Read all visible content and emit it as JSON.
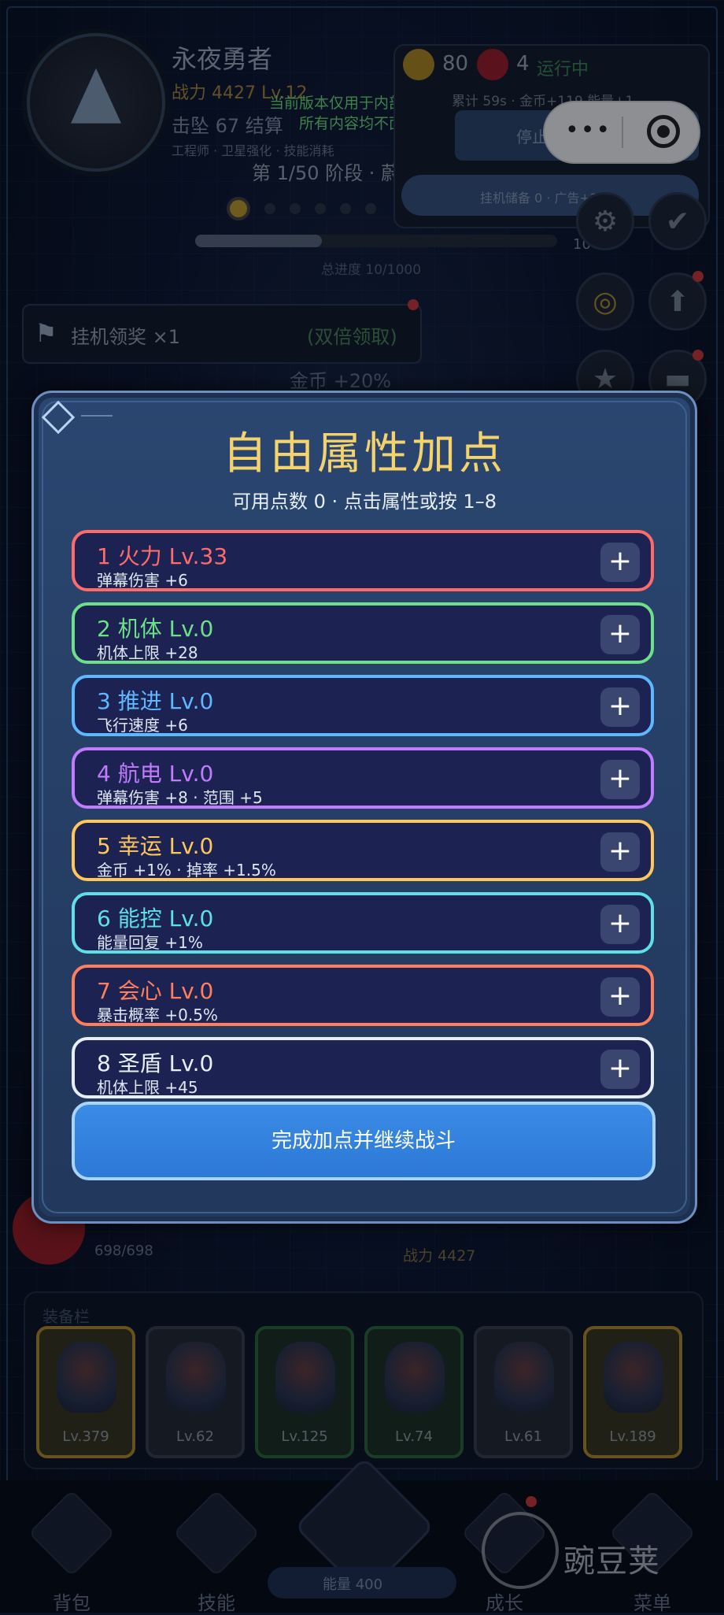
{
  "player": {
    "name": "永夜勇者",
    "power_line": "战力 4427 Lv.12",
    "kills_line": "击坠 67  结算",
    "tags_line": "工程师 · 卫星强化 · 技能消耗"
  },
  "resources": {
    "coins": "80",
    "gems": "4",
    "run_state": "运行中",
    "stats_line": "累计 59s · 金币+119 能量+1",
    "stop_label": "停止挂机",
    "idle_line": "挂机储备 0 · 广告+2h"
  },
  "dev_notice": "当前版本仅用于内部开发测试，\n所有内容均不面向用户",
  "capsule": {
    "more": "•••"
  },
  "stage": {
    "label": "第 1/50 阶段 · 蔚蓝星环",
    "progress_text": "总进度 10/1000",
    "side_value": "10",
    "progress": 0.35
  },
  "idle_reward": {
    "label": "挂机领奖 ×1",
    "double": "(双倍领取)"
  },
  "coin_bonus": "金币 +20%",
  "modal": {
    "title": "自由属性加点",
    "subtitle": "可用点数 0 · 点击属性或按 1–8",
    "plus": "+",
    "attributes": [
      {
        "name": "1  火力  Lv.33",
        "desc": "弹幕伤害 +6",
        "color": "#ff6b6b"
      },
      {
        "name": "2  机体  Lv.0",
        "desc": "机体上限 +28",
        "color": "#6fe08a"
      },
      {
        "name": "3  推进  Lv.0",
        "desc": "飞行速度 +6",
        "color": "#5fb7ff"
      },
      {
        "name": "4  航电  Lv.0",
        "desc": "弹幕伤害 +8 · 范围 +5",
        "color": "#c07bff"
      },
      {
        "name": "5  幸运  Lv.0",
        "desc": "金币 +1% · 掉率 +1.5%",
        "color": "#ffc65a"
      },
      {
        "name": "6  能控  Lv.0",
        "desc": "能量回复 +1%",
        "color": "#5fe0e8"
      },
      {
        "name": "7  会心  Lv.0",
        "desc": "暴击概率 +0.5%",
        "color": "#ff7f5c"
      },
      {
        "name": "8  圣盾  Lv.0",
        "desc": "机体上限 +45",
        "color": "#e8eef8"
      }
    ],
    "finish_label": "完成加点并继续战斗"
  },
  "hud_bottom": {
    "hp": "698/698",
    "power": "战力 4427"
  },
  "equipment": {
    "title": "装备栏",
    "slots": [
      {
        "level": "Lv.379",
        "rarity": "gold"
      },
      {
        "level": "Lv.62",
        "rarity": "gray"
      },
      {
        "level": "Lv.125",
        "rarity": "green"
      },
      {
        "level": "Lv.74",
        "rarity": "green"
      },
      {
        "level": "Lv.61",
        "rarity": "gray"
      },
      {
        "level": "Lv.189",
        "rarity": "gold"
      }
    ]
  },
  "nav": {
    "bag": "背包",
    "skills": "技能",
    "energy": "能量 400",
    "growth": "成长",
    "menu": "菜单"
  },
  "watermark": "豌豆荚",
  "colors": {
    "accent": "#2c79d6",
    "title_gold": "#f4d26c",
    "modal_bg": "#22385c"
  }
}
